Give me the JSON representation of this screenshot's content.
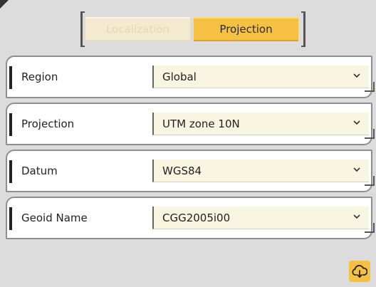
{
  "tabs": [
    {
      "label": "Localization",
      "active": false
    },
    {
      "label": "Projection",
      "active": true
    }
  ],
  "rows": [
    {
      "label": "Region",
      "value": "Global"
    },
    {
      "label": "Projection",
      "value": "UTM zone 10N"
    },
    {
      "label": "Datum",
      "value": "WGS84"
    },
    {
      "label": "Geoid Name",
      "value": "CGG2005i00"
    }
  ],
  "download_button": {
    "icon": "cloud-download-icon"
  },
  "colors": {
    "accent": "#f6c042",
    "tab_inactive": "#f4ead0",
    "select_bg": "#f8f5e0",
    "background": "#dcdcdc"
  }
}
